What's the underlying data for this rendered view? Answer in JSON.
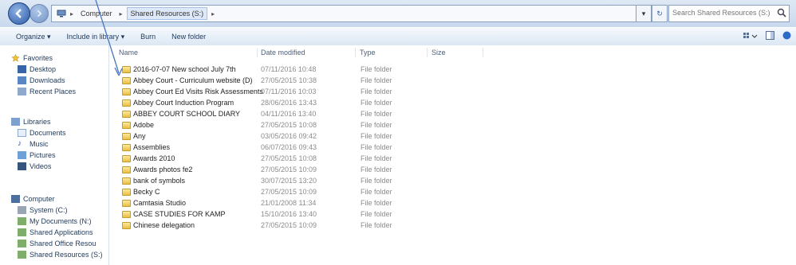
{
  "address": {
    "crumbs": [
      "Computer",
      "Shared Resources (S:)"
    ],
    "search_placeholder": "Search Shared Resources (S:)"
  },
  "toolbar": {
    "organize": "Organize ▾",
    "include": "Include in library ▾",
    "burn": "Burn",
    "new_folder": "New folder"
  },
  "navpane": {
    "favorites": {
      "label": "Favorites",
      "items": [
        "Desktop",
        "Downloads",
        "Recent Places"
      ]
    },
    "libraries": {
      "label": "Libraries",
      "items": [
        "Documents",
        "Music",
        "Pictures",
        "Videos"
      ]
    },
    "computer": {
      "label": "Computer",
      "items": [
        "System (C:)",
        "My Documents (N:)",
        "Shared Applications",
        "Shared Office Resou",
        "Shared Resources (S:)"
      ]
    }
  },
  "columns": {
    "name": "Name",
    "date": "Date modified",
    "type": "Type",
    "size": "Size"
  },
  "files": [
    {
      "name": "2016-07-07 New school July 7th",
      "date": "07/11/2016 10:48",
      "type": "File folder"
    },
    {
      "name": "Abbey Court - Curriculum website (D)",
      "date": "27/05/2015 10:38",
      "type": "File folder"
    },
    {
      "name": "Abbey Court Ed Visits Risk Assessments",
      "date": "07/11/2016 10:03",
      "type": "File folder"
    },
    {
      "name": "Abbey Court Induction Program",
      "date": "28/06/2016 13:43",
      "type": "File folder"
    },
    {
      "name": "ABBEY COURT SCHOOL DIARY",
      "date": "04/11/2016 13:40",
      "type": "File folder"
    },
    {
      "name": "Adobe",
      "date": "27/05/2015 10:08",
      "type": "File folder"
    },
    {
      "name": "Any",
      "date": "03/05/2016 09:42",
      "type": "File folder"
    },
    {
      "name": "Assemblies",
      "date": "06/07/2016 09:43",
      "type": "File folder"
    },
    {
      "name": "Awards 2010",
      "date": "27/05/2015 10:08",
      "type": "File folder"
    },
    {
      "name": "Awards photos fe2",
      "date": "27/05/2015 10:09",
      "type": "File folder"
    },
    {
      "name": "bank of symbols",
      "date": "30/07/2015 13:20",
      "type": "File folder"
    },
    {
      "name": "Becky C",
      "date": "27/05/2015 10:09",
      "type": "File folder"
    },
    {
      "name": "Camtasia Studio",
      "date": "21/01/2008 11:34",
      "type": "File folder"
    },
    {
      "name": "CASE STUDIES FOR KAMP",
      "date": "15/10/2016 13:40",
      "type": "File folder"
    },
    {
      "name": "Chinese delegation",
      "date": "27/05/2015 10:09",
      "type": "File folder"
    }
  ],
  "colors": {
    "accent": "#2d5aa8",
    "folder": "#e7c045",
    "nav_text": "#1e395b"
  }
}
